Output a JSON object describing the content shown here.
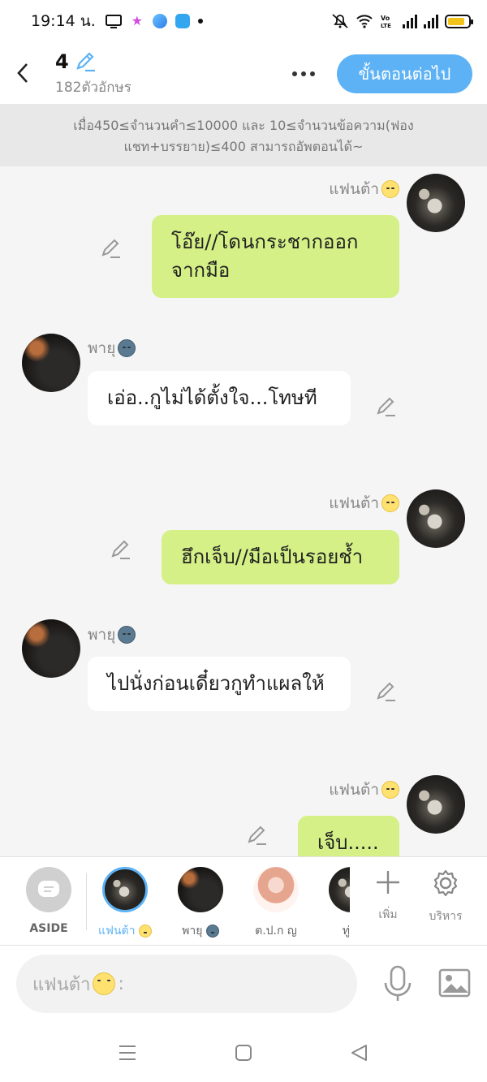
{
  "status_bar": {
    "time": "19:14 น.",
    "battery_level": 0.85,
    "colors": {
      "battery": "#f2c318"
    }
  },
  "header": {
    "title": "4",
    "char_count": "182ตัวอักษร",
    "next_label": "ขั้นตอนต่อไป",
    "colors": {
      "accent": "#5db2f5"
    }
  },
  "notice": "เมื่อ450≤จำนวนคำ≤10000 และ 10≤จำนวนข้อความ(ฟองแชท+บรรยาย)≤400 สามารถอัพตอนได้~",
  "messages": [
    {
      "sender": "แฟนต้า",
      "side": "right",
      "text": "โอ๊ย//โดนกระชากออกจากมือ"
    },
    {
      "sender": "พายุ",
      "side": "left",
      "text": "เอ่อ..กูไม่ได้ตั้งใจ...โทษที"
    },
    {
      "sender": "แฟนต้า",
      "side": "right",
      "text": "ฮึกเจ็บ//มือเป็นรอยช้ำ"
    },
    {
      "sender": "พายุ",
      "side": "left",
      "text": "ไปนั่งก่อนเดี๋ยวกูทำแผลให้"
    },
    {
      "sender": "แฟนต้า",
      "side": "right",
      "text": "เจ็บ....."
    }
  ],
  "character_bar": {
    "aside_label": "ASIDE",
    "characters": [
      {
        "label": "แฟนต้า",
        "selected": true
      },
      {
        "label": "พายุ",
        "selected": false
      },
      {
        "label": "ต.ป.ก ญ",
        "selected": false
      },
      {
        "label": "ทู่",
        "selected": false
      }
    ],
    "add_label": "เพิ่ม",
    "manage_label": "บริหาร"
  },
  "input": {
    "placeholder": "แฟนต้า",
    "suffix": ":"
  },
  "colors": {
    "bubble_right": "#d5f086",
    "bubble_left": "#ffffff",
    "background": "#f5f5f5"
  }
}
